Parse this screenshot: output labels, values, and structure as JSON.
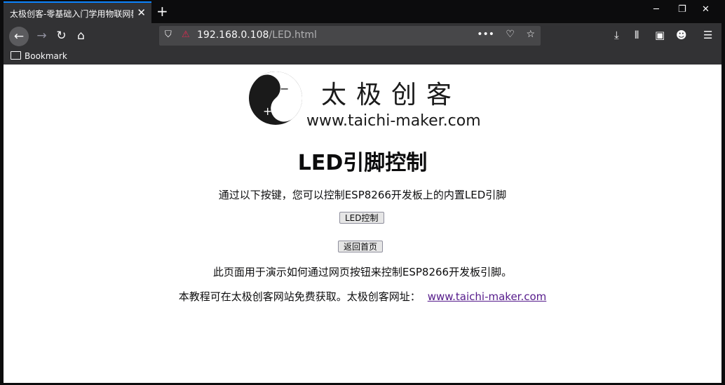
{
  "browser": {
    "tab": {
      "title": "太极创客-零基础入门学用物联网教"
    },
    "url": {
      "host": "192.168.0.108",
      "path": "/LED.html"
    },
    "bookmarks": [
      {
        "label": "Bookmark"
      }
    ]
  },
  "page": {
    "logo": {
      "chinese": "太极创客",
      "url": "www.taichi-maker.com"
    },
    "title": "LED引脚控制",
    "intro": "通过以下按键，您可以控制ESP8266开发板上的内置LED引脚",
    "buttons": {
      "led": "LED控制",
      "home": "返回首页"
    },
    "description": "此页面用于演示如何通过网页按钮来控制ESP8266开发板引脚。",
    "footer": {
      "text": "本教程可在太极创客网站免费获取。太极创客网址：",
      "link": "www.taichi-maker.com"
    }
  }
}
